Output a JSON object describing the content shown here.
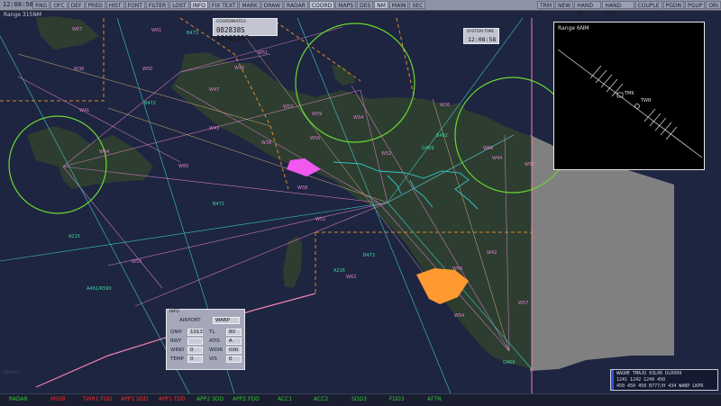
{
  "toolbar": {
    "clock": "12:08:58",
    "left_buttons": [
      "RNG",
      "OFC",
      "DEF",
      "PRED",
      "HIST",
      "FONT",
      "FILTER",
      "LOST",
      "INFO",
      "FIX TEXT",
      "MARK",
      "DRAW",
      "RADAR",
      "COORD",
      "MAPS",
      "DES",
      "NM",
      "MAIN",
      "SEC"
    ],
    "right_buttons": [
      "TRM",
      "NEW",
      "HAND IN",
      "HAND OFF",
      "COUPLE",
      "PGDN",
      "PGUP",
      "ORI"
    ]
  },
  "range": {
    "label": "Range  315NM"
  },
  "coordinates": {
    "title": "COORDINATES",
    "value": "082838S 1360219E"
  },
  "system_time": {
    "title": "SYSTEM TIME",
    "value": "12:08:58"
  },
  "inset": {
    "label": "Range  6NM",
    "labels": [
      "TMK",
      "TWR"
    ]
  },
  "map": {
    "routes": [
      "W67",
      "B473",
      "W61",
      "W36",
      "W50",
      "W46",
      "W41",
      "W47",
      "B472",
      "W51",
      "W53",
      "W59",
      "W54",
      "W65",
      "W64",
      "W43",
      "W38",
      "W56",
      "W52",
      "G469",
      "B462",
      "W36",
      "W66",
      "W44",
      "W57",
      "W58",
      "B472",
      "W51",
      "A215",
      "W42",
      "B473",
      "W56",
      "W53",
      "W62",
      "A216",
      "A461/R590",
      "W54",
      "W57",
      "G469"
    ]
  },
  "info": {
    "title": "INFO",
    "airport_label": "AIRPORT",
    "airport": "WABP",
    "qnh_label": "QNH",
    "qnh": "1013",
    "tl_label": "TL",
    "tl": "80",
    "rwy_label": "RWY",
    "rwy": "",
    "atis_label": "ATIS",
    "atis": "A",
    "wind_label": "WIND",
    "wind": "0",
    "wdir_label": "WDIR",
    "wdir": "000",
    "temp_label": "TEMP",
    "temp": "0",
    "vis_label": "VIS",
    "vis": "0"
  },
  "flight_strip": {
    "row1": "WAGHE  TMAJU  03L06  DLR999",
    "row2": "1241   1242   1249              450",
    "row3": "450    450    450  B777/H 434  WABP LKPR"
  },
  "statusbar": [
    {
      "label": "RADAR",
      "color": "#2ec82e"
    },
    {
      "label": "MSSR",
      "color": "#e83030"
    },
    {
      "label": "TWR1 FDD",
      "color": "#e83030"
    },
    {
      "label": "APP1 SDD",
      "color": "#e83030"
    },
    {
      "label": "APP1 FDD",
      "color": "#e83030"
    },
    {
      "label": "APP2 SDD",
      "color": "#2ec82e"
    },
    {
      "label": "APP2 FDD",
      "color": "#2ec82e"
    },
    {
      "label": "ACC1",
      "color": "#2ec82e"
    },
    {
      "label": "ACC2",
      "color": "#2ec82e"
    },
    {
      "label": "SDD3",
      "color": "#2ec82e"
    },
    {
      "label": "FDD3",
      "color": "#2ec82e"
    },
    {
      "label": "AFTN",
      "color": "#2ec82e"
    }
  ],
  "watermark": "AIRNAV",
  "colors": {
    "land": "#2d3e30",
    "sea": "#1e2540",
    "foreign": "#808080",
    "circle": "#6ad832",
    "route_pink": "#d080c0",
    "route_cyan": "#40c8c8",
    "fir_orange": "#d88a30"
  }
}
